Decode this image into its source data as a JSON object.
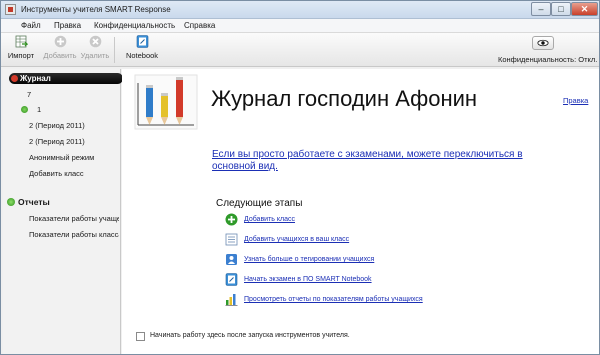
{
  "window": {
    "title": "Инструменты учителя SMART Response",
    "minimize": "–",
    "maximize": "□",
    "close": "✕"
  },
  "menu": {
    "items": [
      "Файл",
      "Правка",
      "Конфиденциальность",
      "Справка"
    ]
  },
  "toolbar": {
    "import_label": "Импорт",
    "add_label": "Добавить",
    "delete_label": "Удалить",
    "notebook_label": "Notebook",
    "privacy_label": "Конфиденциальность: Откл."
  },
  "sidebar": {
    "journal_label": "Журнал",
    "items": [
      "7",
      "1",
      "2 (Период 2011)",
      "2 (Период 2011)",
      "Анонимный режим",
      "Добавить класс"
    ],
    "reports_label": "Отчеты",
    "report_items": [
      "Показатели работы учаще",
      "Показатели работы класса"
    ]
  },
  "main": {
    "heading": "Журнал господин Афонин",
    "help_link": "Правка",
    "exam_link": "Если вы просто работаете с экзаменами, можете переключиться в основной вид.",
    "next_steps_title": "Следующие этапы",
    "steps": [
      {
        "label": "Добавить класс",
        "icon": "add-class-icon"
      },
      {
        "label": "Добавить учащихся в ваш класс",
        "icon": "add-students-icon"
      },
      {
        "label": "Узнать больше о тегировании учащихся",
        "icon": "tagging-icon"
      },
      {
        "label": "Начать экзамен в ПО SMART Notebook",
        "icon": "notebook-icon"
      },
      {
        "label": "Просмотреть отчеты по показателям работы учащихся",
        "icon": "reports-icon"
      }
    ],
    "startup_label": "Начинать работу здесь после запуска инструментов учителя."
  },
  "colors": {
    "link": "#1b2fb5",
    "journal_header_bg": "#0a0a0a",
    "accent_red": "#d23a2a",
    "accent_green": "#2f8f1f"
  }
}
